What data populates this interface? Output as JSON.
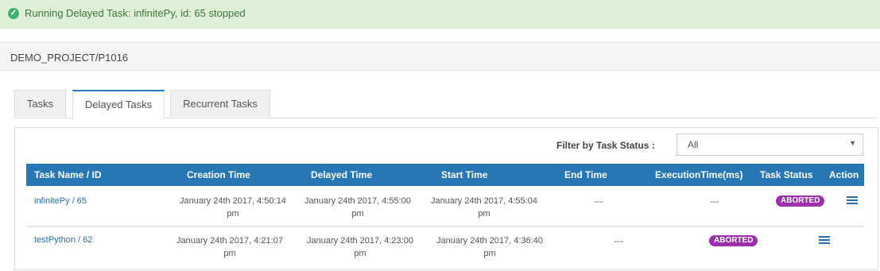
{
  "alert": {
    "message": "Running Delayed Task: infinitePy, id: 65 stopped",
    "icon": "check-circle-icon",
    "color": "#3c763d"
  },
  "breadcrumb": {
    "path": "DEMO_PROJECT/P1016"
  },
  "tabs": [
    {
      "label": "Tasks",
      "active": false
    },
    {
      "label": "Delayed Tasks",
      "active": true
    },
    {
      "label": "Recurrent Tasks",
      "active": false
    }
  ],
  "filter": {
    "label": "Filter by Task Status :",
    "selected": "All"
  },
  "table": {
    "header_color": "#2677b3",
    "columns": [
      "Task Name / ID",
      "Creation Time",
      "Delayed Time",
      "Start Time",
      "End Time",
      "ExecutionTime(ms)",
      "Task Status",
      "Action"
    ],
    "rows": [
      {
        "task": "infinitePy / 65",
        "creation_1": "January 24th 2017, 4:50:14",
        "creation_2": "pm",
        "delayed_1": "January 24th 2017, 4:55:00",
        "delayed_2": "pm",
        "start_1": "January 24th 2017, 4:55:04",
        "start_2": "pm",
        "end": "---",
        "exec": "---",
        "status": "ABORTED",
        "action_icon": "list-icon"
      },
      {
        "task": "testPython / 62",
        "creation_1": "January 24th 2017, 4:21:07",
        "creation_2": "pm",
        "delayed_1": "January 24th 2017, 4:23:00",
        "delayed_2": "pm",
        "start_1": "January 24th 2017, 4:36:40",
        "start_2": "pm",
        "end": "---",
        "status": "ABORTED",
        "action_icon": "list-icon"
      }
    ]
  },
  "status_badge_color": "#9b2fae"
}
